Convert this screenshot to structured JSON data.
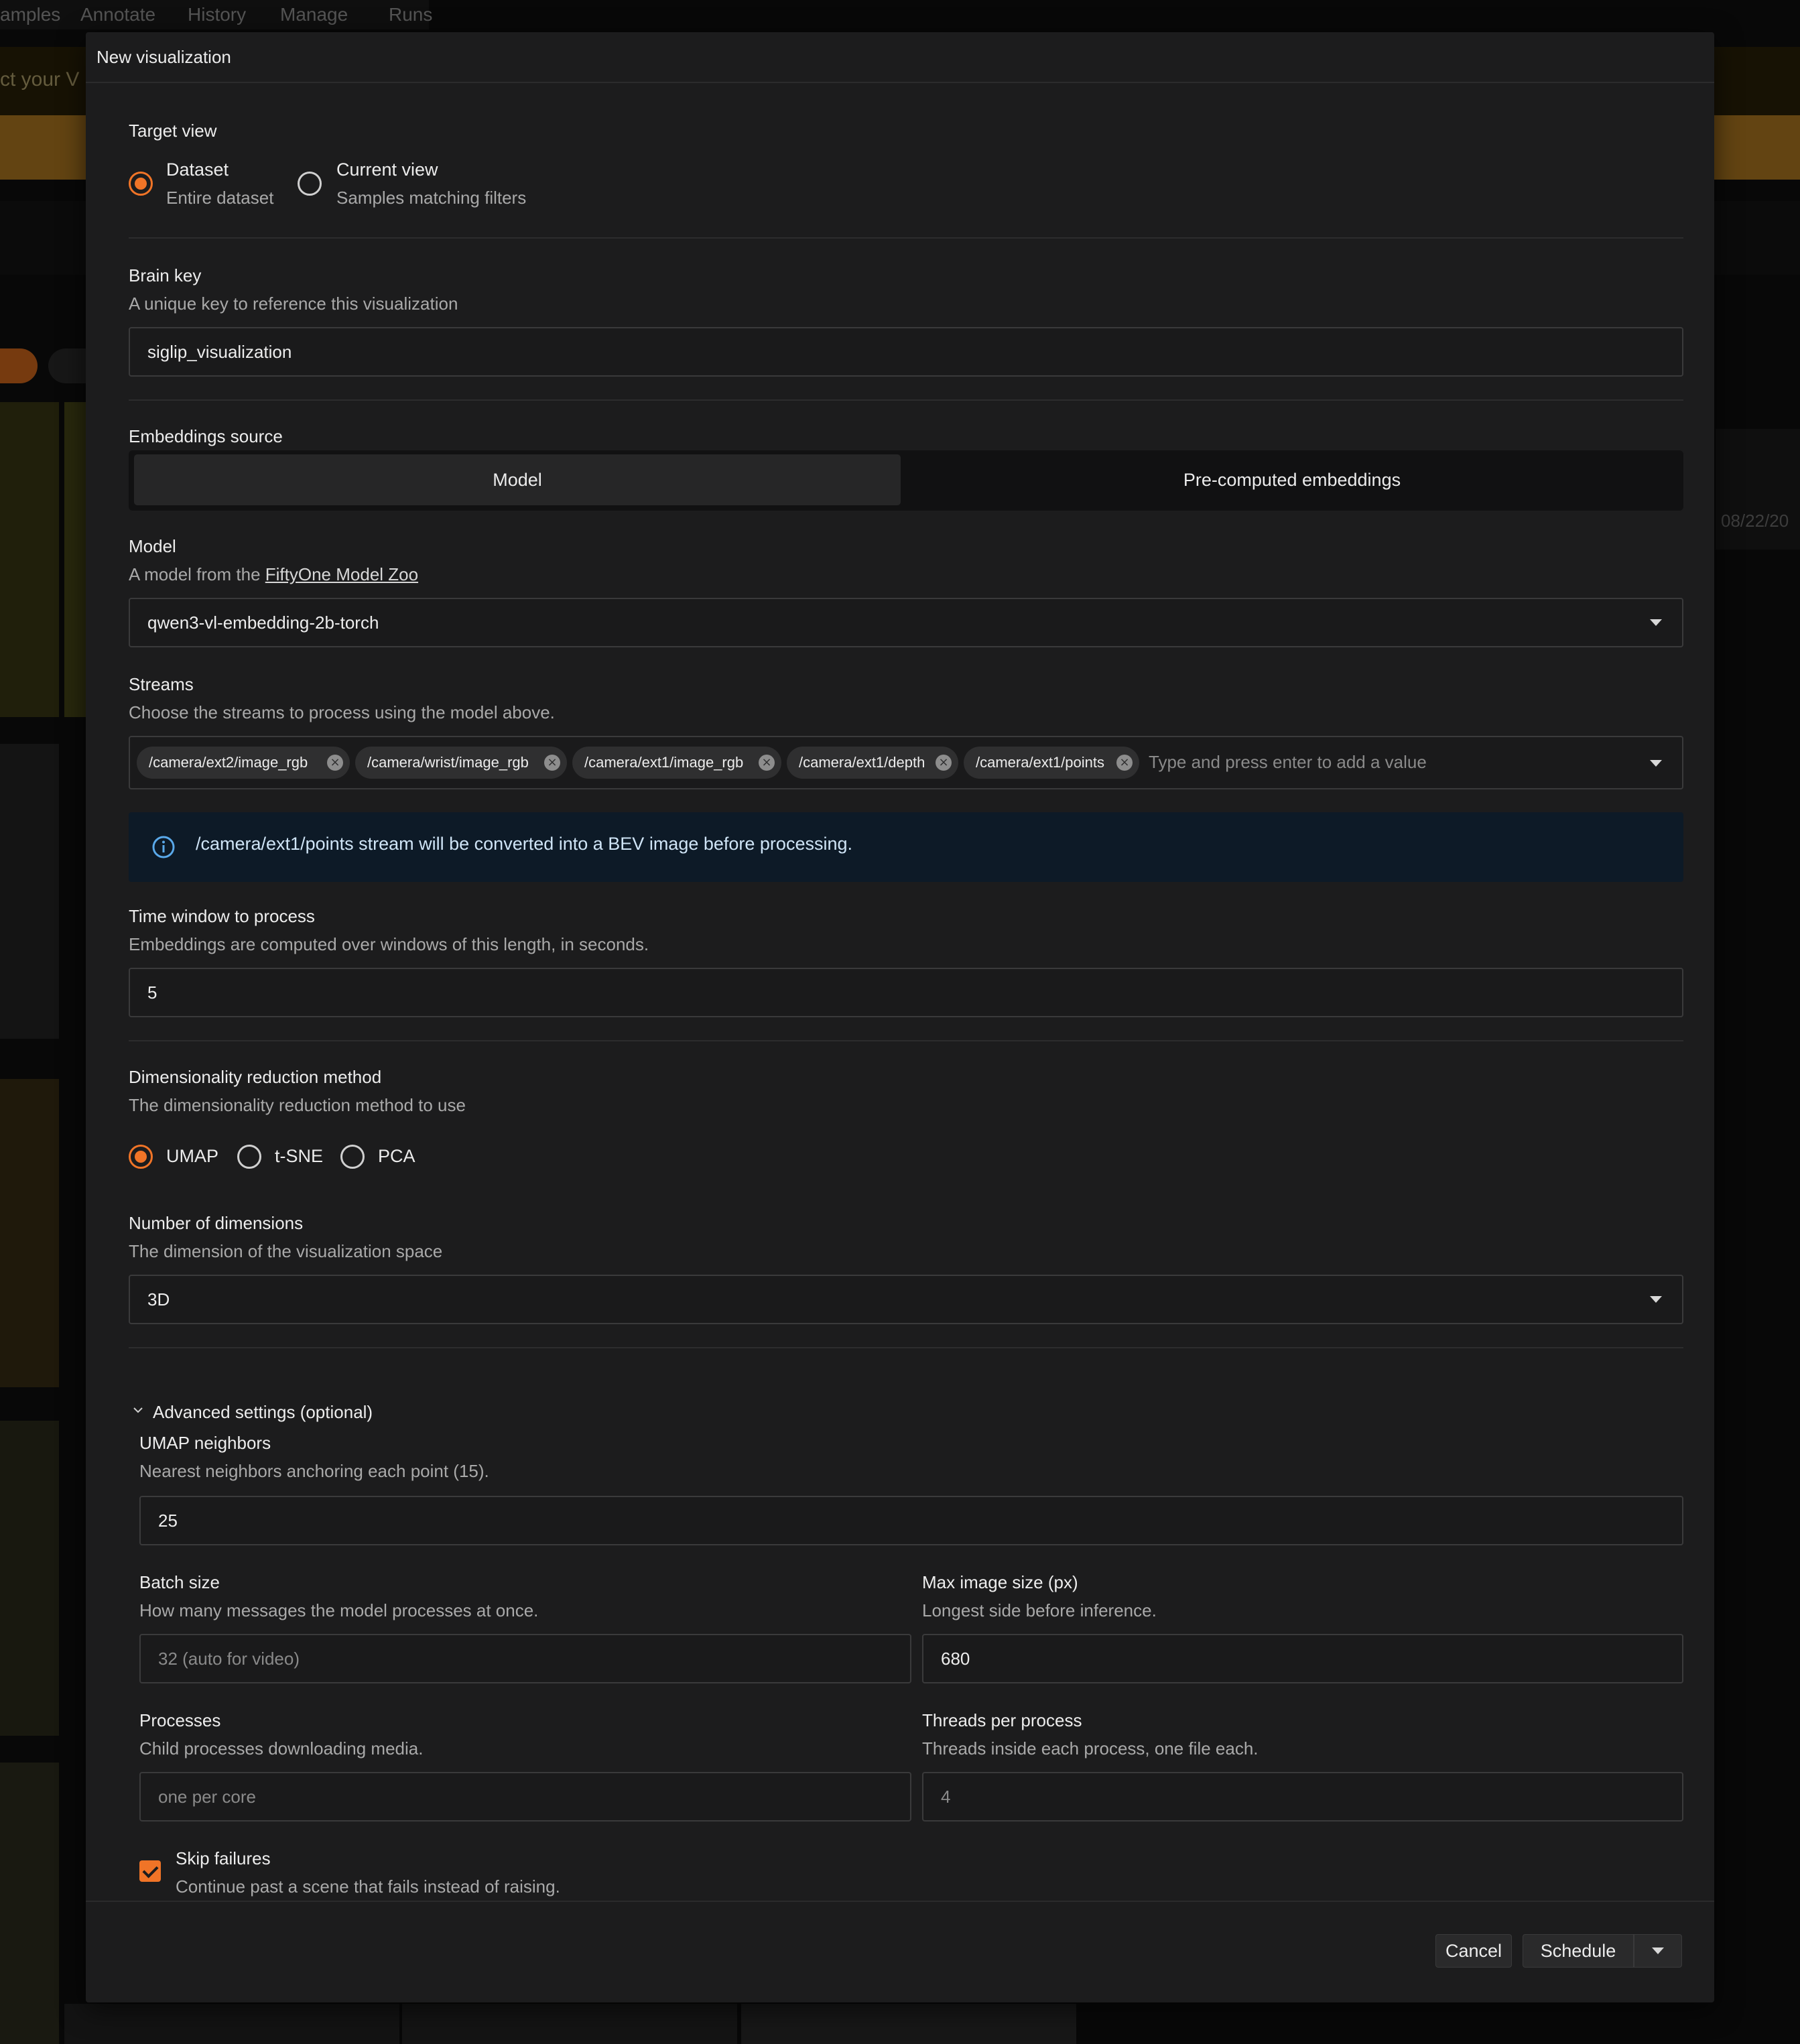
{
  "background": {
    "nav_items": [
      "amples",
      "Annotate",
      "History",
      "Manage",
      "Runs"
    ],
    "banner_text": "ct your V",
    "side_date": "08/22/20"
  },
  "modal": {
    "title": "New visualization",
    "target_view": {
      "label": "Target view",
      "options": [
        {
          "label": "Dataset",
          "desc": "Entire dataset",
          "selected": true
        },
        {
          "label": "Current view",
          "desc": "Samples matching filters",
          "selected": false
        }
      ]
    },
    "brain_key": {
      "label": "Brain key",
      "desc": "A unique key to reference this visualization",
      "value": "siglip_visualization"
    },
    "embeddings_source": {
      "label": "Embeddings source",
      "options": [
        "Model",
        "Pre-computed embeddings"
      ],
      "selected": "Model"
    },
    "model": {
      "label": "Model",
      "desc_prefix": "A model from the ",
      "desc_link": "FiftyOne Model Zoo",
      "value": "qwen3-vl-embedding-2b-torch"
    },
    "streams": {
      "label": "Streams",
      "desc": "Choose the streams to process using the model above.",
      "chips": [
        "/camera/ext2/image_rgb",
        "/camera/wrist/image_rgb",
        "/camera/ext1/image_rgb",
        "/camera/ext1/depth",
        "/camera/ext1/points"
      ],
      "placeholder": "Type and press enter to add a value"
    },
    "info_message": "/camera/ext1/points stream will be converted into a BEV image before processing.",
    "time_window": {
      "label": "Time window to process",
      "desc": "Embeddings are computed over windows of this length, in seconds.",
      "value": "5"
    },
    "reduction": {
      "label": "Dimensionality reduction method",
      "desc": "The dimensionality reduction method to use",
      "options": [
        "UMAP",
        "t-SNE",
        "PCA"
      ],
      "selected": "UMAP"
    },
    "dimensions": {
      "label": "Number of dimensions",
      "desc": "The dimension of the visualization space",
      "value": "3D"
    },
    "advanced": {
      "toggle_label": "Advanced settings (optional)",
      "umap_neighbors": {
        "label": "UMAP neighbors",
        "desc": "Nearest neighbors anchoring each point (15).",
        "value": "25"
      },
      "batch_size": {
        "label": "Batch size",
        "desc": "How many messages the model processes at once.",
        "placeholder": "32 (auto for video)"
      },
      "max_image_size": {
        "label": "Max image size (px)",
        "desc": "Longest side before inference.",
        "value": "680"
      },
      "processes": {
        "label": "Processes",
        "desc": "Child processes downloading media.",
        "placeholder": "one per core"
      },
      "threads": {
        "label": "Threads per process",
        "desc": "Threads inside each process, one file each.",
        "placeholder": "4"
      },
      "skip_failures": {
        "label": "Skip failures",
        "desc": "Continue past a scene that fails instead of raising.",
        "checked": true
      }
    },
    "footer": {
      "cancel_label": "Cancel",
      "schedule_label": "Schedule"
    }
  }
}
